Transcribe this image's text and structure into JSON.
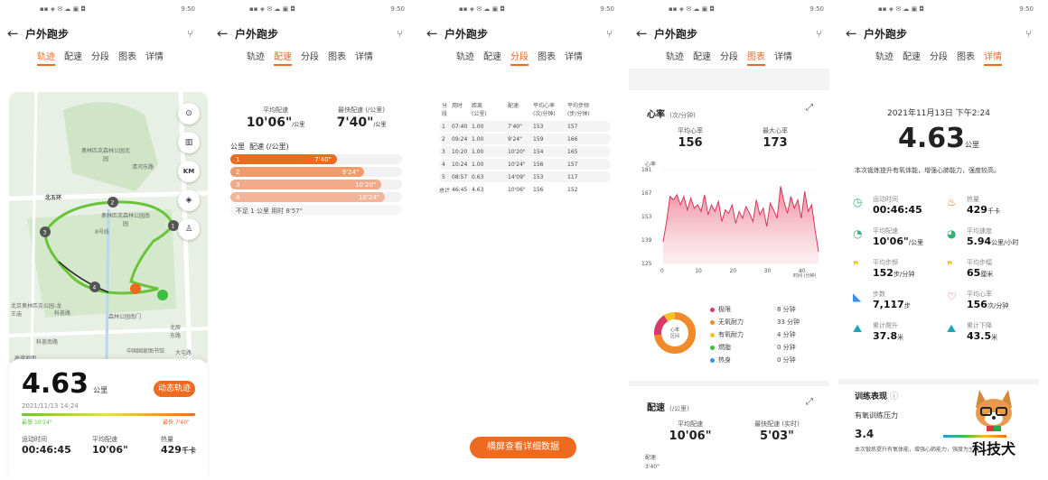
{
  "status_time": "9:50",
  "title": "户外跑步",
  "tabs": [
    "轨迹",
    "配速",
    "分段",
    "图表",
    "详情"
  ],
  "map": {
    "labels": [
      "北五环",
      "奥林匹克森林公园北园",
      "清河东路",
      "奥林匹克森林公园南园",
      "北京奥林匹克公园-龙王庙",
      "科荟路",
      "森林公园南门",
      "北辰东路",
      "科荟南路",
      "中国国家图书馆",
      "高德地图",
      "8号线",
      "大屯路"
    ],
    "ctl_icons": [
      "compass-icon",
      "map-icon",
      "km-icon",
      "layers-icon",
      "runner-icon"
    ],
    "km": "KM",
    "markers": [
      "1",
      "2",
      "3",
      "4"
    ]
  },
  "summary": {
    "distance": "4.63",
    "distance_unit": "公里",
    "date": "2021/11/13 14:24",
    "dynamic_btn": "动态轨迹",
    "slowest": "最慢",
    "slowest_val": "10'24\"",
    "fastest": "最快",
    "fastest_val": "7'40\"",
    "stats": [
      {
        "label": "运动时间",
        "value": "00:46:45",
        "unit": ""
      },
      {
        "label": "平均配速",
        "value": "10'06\"",
        "unit": ""
      },
      {
        "label": "热量",
        "value": "429",
        "unit": "千卡"
      }
    ]
  },
  "pace": {
    "avg_label": "平均配速",
    "avg": "10'06\"",
    "avg_unit": "/公里",
    "best_label": "最快配速 (/公里)",
    "best": "7'40\"",
    "best_unit": "/公里",
    "list_header": "公里  配速 (/公里)",
    "rows": [
      {
        "km": "1",
        "pace": "7'40\"",
        "frac": 0.62
      },
      {
        "km": "2",
        "pace": "9'24\"",
        "frac": 0.78
      },
      {
        "km": "3",
        "pace": "10'20\"",
        "frac": 0.88
      },
      {
        "km": "4",
        "pace": "10'24\"",
        "frac": 0.9
      }
    ],
    "footer": "不足 1 公里 用时 8'57\""
  },
  "segments": {
    "headers": [
      "分段",
      "用时",
      "距离\n(公里)",
      "配速",
      "平均心率\n(次/分钟)",
      "平均步频\n(步/分钟)"
    ],
    "rows": [
      [
        "1",
        "07:40",
        "1.00",
        "7'40\"",
        "153",
        "157"
      ],
      [
        "2",
        "09:24",
        "1.00",
        "9'24\"",
        "159",
        "166"
      ],
      [
        "3",
        "10:20",
        "1.00",
        "10'20\"",
        "154",
        "165"
      ],
      [
        "4",
        "10:24",
        "1.00",
        "10'24\"",
        "156",
        "157"
      ],
      [
        "5",
        "08:57",
        "0.63",
        "14'09\"",
        "153",
        "117"
      ],
      [
        "总计",
        "46:45",
        "4.63",
        "10'06\"",
        "156",
        "152"
      ]
    ],
    "landscape_btn": "横屏查看详细数据"
  },
  "charts": {
    "hr_title": "心率",
    "hr_unit": "(次/分钟)",
    "avg_hr_label": "平均心率",
    "avg_hr": "156",
    "max_hr_label": "最大心率",
    "max_hr": "173",
    "y_axis_title": "心率",
    "x_axis_title": "时间 (分钟)",
    "donut_label": "心率\n区间",
    "zones": [
      {
        "name": "极限",
        "value": "8 分钟",
        "color": "#d63a6a"
      },
      {
        "name": "无氧耐力",
        "value": "33 分钟",
        "color": "#f08a2a"
      },
      {
        "name": "有氧耐力",
        "value": "4 分钟",
        "color": "#f5c02a"
      },
      {
        "name": "燃脂",
        "value": "0 分钟",
        "color": "#3ec03e"
      },
      {
        "name": "热身",
        "value": "0 分钟",
        "color": "#3a8ef0"
      }
    ],
    "pace_title": "配速",
    "pace_unit": "(/公里)",
    "pace_avg_label": "平均配速",
    "pace_avg": "10'06\"",
    "pace_best_label": "最快配速 (实时)",
    "pace_best": "5'03\"",
    "pace_axis": "配速",
    "pace_tick": "3'40\""
  },
  "chart_data": {
    "type": "area",
    "title": "心率",
    "ylabel": "心率",
    "xlabel": "时间 (分钟)",
    "ylim": [
      125,
      181
    ],
    "xlim": [
      0,
      45
    ],
    "yticks": [
      125,
      139,
      153,
      167,
      181
    ],
    "xticks": [
      0,
      10,
      20,
      30,
      40
    ],
    "x": [
      0,
      1,
      2,
      3,
      4,
      5,
      6,
      7,
      8,
      9,
      10,
      11,
      12,
      13,
      14,
      15,
      16,
      17,
      18,
      19,
      20,
      21,
      22,
      23,
      24,
      25,
      26,
      27,
      28,
      29,
      30,
      31,
      32,
      33,
      34,
      35,
      36,
      37,
      38,
      39,
      40,
      41,
      42,
      43,
      44,
      45
    ],
    "values": [
      138,
      150,
      165,
      163,
      166,
      160,
      165,
      157,
      164,
      158,
      160,
      156,
      166,
      154,
      160,
      156,
      162,
      150,
      157,
      155,
      160,
      149,
      156,
      152,
      159,
      155,
      150,
      163,
      154,
      158,
      147,
      161,
      157,
      152,
      171,
      162,
      155,
      165,
      158,
      163,
      152,
      168,
      156,
      160,
      145,
      132
    ]
  },
  "details": {
    "date": "2021年11月13日 下午2:24",
    "distance": "4.63",
    "distance_unit": "公里",
    "desc": "本次锻炼提升有氧体能，增强心肺能力，强度较高。",
    "items": [
      {
        "icon": "clock-icon",
        "label": "运动时间",
        "value": "00:46:45",
        "unit": "",
        "color": "#2bb673",
        "glyph": "◷"
      },
      {
        "icon": "flame-icon",
        "label": "热量",
        "value": "429",
        "unit": "千卡",
        "color": "#ee6a1f",
        "glyph": "♨"
      },
      {
        "icon": "gauge-icon",
        "label": "平均配速",
        "value": "10'06\"",
        "unit": "/公里",
        "color": "#2bb673",
        "glyph": "◔"
      },
      {
        "icon": "speed-icon",
        "label": "平均速度",
        "value": "5.94",
        "unit": "公里/小时",
        "color": "#2bb673",
        "glyph": "◕"
      },
      {
        "icon": "footsteps-icon",
        "label": "平均步频",
        "value": "152",
        "unit": "步/分钟",
        "color": "#e8b21c",
        "glyph": "❞"
      },
      {
        "icon": "stride-icon",
        "label": "平均步幅",
        "value": "65",
        "unit": "厘米",
        "color": "#e8b21c",
        "glyph": "❞"
      },
      {
        "icon": "shoe-icon",
        "label": "步数",
        "value": "7,117",
        "unit": "步",
        "color": "#3a8ef0",
        "glyph": "◣"
      },
      {
        "icon": "heart-icon",
        "label": "平均心率",
        "value": "156",
        "unit": "次/分钟",
        "color": "#e0457b",
        "glyph": "♡"
      },
      {
        "icon": "climb-icon",
        "label": "累计爬升",
        "value": "37.8",
        "unit": "米",
        "color": "#1aa6b7",
        "glyph": "⛰"
      },
      {
        "icon": "descent-icon",
        "label": "累计下降",
        "value": "43.5",
        "unit": "米",
        "color": "#1aa6b7",
        "glyph": "⛰"
      }
    ],
    "training_title": "训练表现",
    "training_sub": "有氧训练压力",
    "training_value": "3.4",
    "training_desc": "本次锻炼提升有氧体能，增强心肺能力，强度为主。"
  },
  "watermark": "科技犬"
}
